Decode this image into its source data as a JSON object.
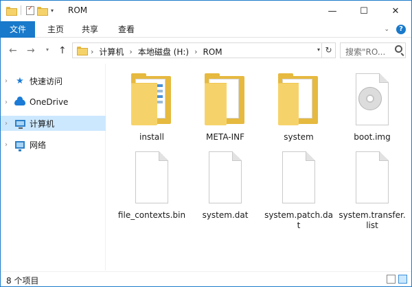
{
  "window": {
    "title": "ROM",
    "controls": {
      "minimize": "—",
      "maximize": "☐",
      "close": "✕"
    }
  },
  "ribbon": {
    "tabs": [
      {
        "label": "文件",
        "active": true
      },
      {
        "label": "主页"
      },
      {
        "label": "共享"
      },
      {
        "label": "查看"
      }
    ],
    "help_label": "?"
  },
  "address_bar": {
    "breadcrumb": [
      "计算机",
      "本地磁盘 (H:)",
      "ROM"
    ],
    "search_placeholder": "搜索\"RO..."
  },
  "nav_pane": {
    "items": [
      {
        "label": "快速访问",
        "icon": "star-icon"
      },
      {
        "label": "OneDrive",
        "icon": "cloud-icon"
      },
      {
        "label": "计算机",
        "icon": "computer-icon",
        "selected": true
      },
      {
        "label": "网络",
        "icon": "network-icon"
      }
    ]
  },
  "files": [
    {
      "name": "install",
      "kind": "folder"
    },
    {
      "name": "META-INF",
      "kind": "folder"
    },
    {
      "name": "system",
      "kind": "folder"
    },
    {
      "name": "boot.img",
      "kind": "disc-image"
    },
    {
      "name": "file_contexts.bin",
      "kind": "file"
    },
    {
      "name": "system.dat",
      "kind": "file"
    },
    {
      "name": "system.patch.dat",
      "kind": "file"
    },
    {
      "name": "system.transfer.list",
      "kind": "file"
    }
  ],
  "status": {
    "item_count": "8 个项目"
  },
  "colors": {
    "accent": "#1979ca",
    "selection": "#cce8ff",
    "folder": "#f6d36a"
  }
}
